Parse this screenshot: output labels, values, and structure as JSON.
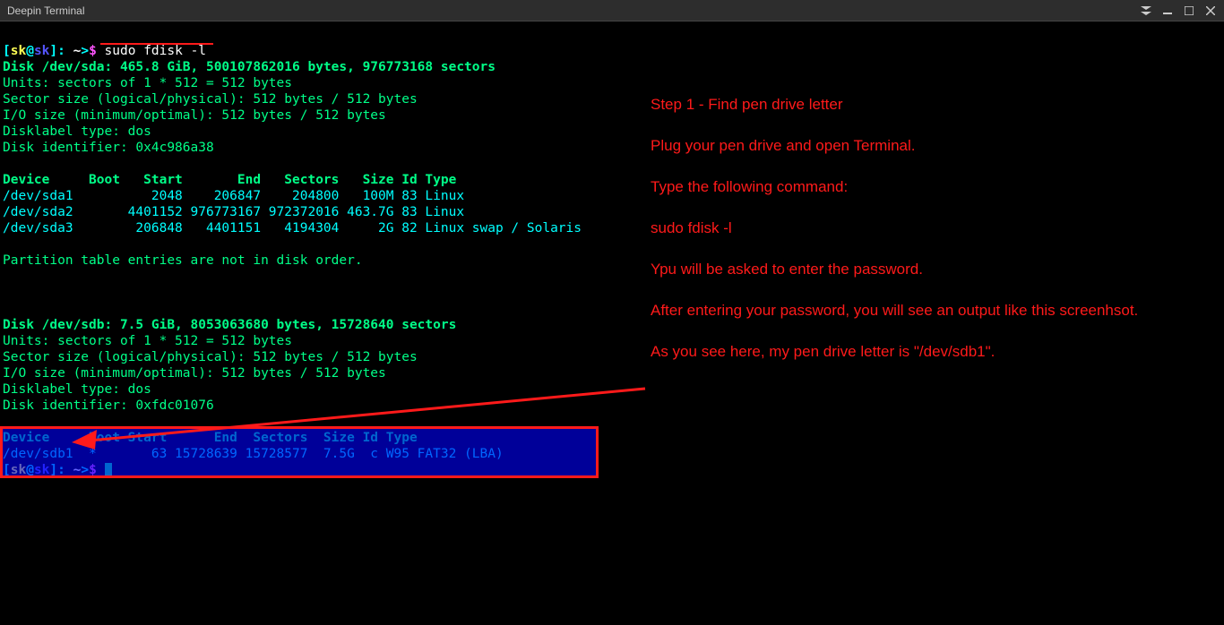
{
  "window": {
    "title": "Deepin Terminal"
  },
  "prompt": {
    "user": "sk",
    "host": "sk",
    "path": "~",
    "symbol": "$",
    "command": "sudo fdisk -l"
  },
  "disk_sda": {
    "header": "Disk /dev/sda: 465.8 GiB, 500107862016 bytes, 976773168 sectors",
    "units": "Units: sectors of 1 * 512 = 512 bytes",
    "sector": "Sector size (logical/physical): 512 bytes / 512 bytes",
    "io": "I/O size (minimum/optimal): 512 bytes / 512 bytes",
    "label": "Disklabel type: dos",
    "ident": "Disk identifier: 0x4c986a38",
    "table_header": "Device     Boot   Start       End   Sectors   Size Id Type",
    "rows": [
      "/dev/sda1          2048    206847    204800   100M 83 Linux",
      "/dev/sda2       4401152 976773167 972372016 463.7G 83 Linux",
      "/dev/sda3        206848   4401151   4194304     2G 82 Linux swap / Solaris"
    ],
    "note": "Partition table entries are not in disk order."
  },
  "disk_sdb": {
    "header": "Disk /dev/sdb: 7.5 GiB, 8053063680 bytes, 15728640 sectors",
    "units": "Units: sectors of 1 * 512 = 512 bytes",
    "sector": "Sector size (logical/physical): 512 bytes / 512 bytes",
    "io": "I/O size (minimum/optimal): 512 bytes / 512 bytes",
    "label": "Disklabel type: dos",
    "ident": "Disk identifier: 0xfdc01076",
    "table_header": "Device     Boot Start      End  Sectors  Size Id Type",
    "rows": [
      "/dev/sdb1  *       63 15728639 15728577  7.5G  c W95 FAT32 (LBA)"
    ]
  },
  "instructions": {
    "step": "Step 1 - Find pen drive letter",
    "l1": "Plug your pen drive and open Terminal.",
    "l2": "Type the following command:",
    "l3": "sudo fdisk -l",
    "l4": "Ypu will be asked to enter the password.",
    "l5": "After entering your password, you will see an output like this screenhsot.",
    "l6": "As you see here, my pen drive letter is \"/dev/sdb1\"."
  }
}
